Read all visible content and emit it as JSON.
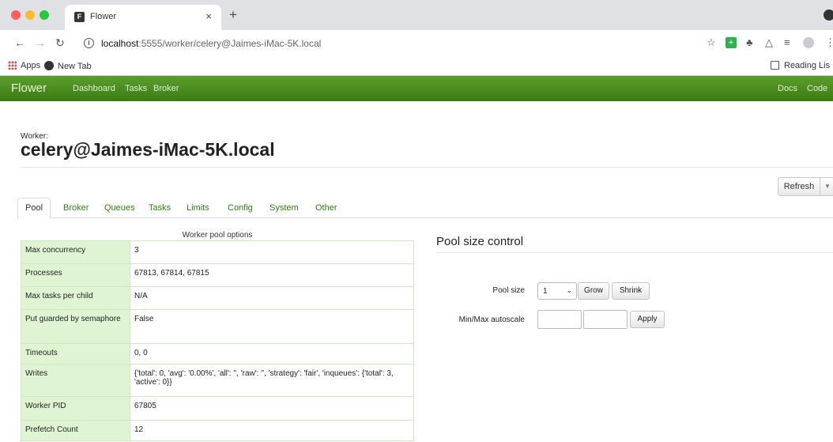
{
  "browser": {
    "tab_title": "Flower",
    "tab_favicon": "F",
    "close_glyph": "×",
    "new_tab_glyph": "+",
    "url_host": "localhost",
    "url_path": ":5555/worker/celery@Jaimes-iMac-5K.local",
    "colors": {
      "close": "#ff5f57",
      "minimize": "#febc2e",
      "maximize": "#28c840"
    }
  },
  "bookmarks": {
    "apps_label": "Apps",
    "newtab_label": "New Tab",
    "reading_list_label": "Reading Lis"
  },
  "navbar": {
    "brand": "Flower",
    "links": [
      "Dashboard",
      "Tasks",
      "Broker"
    ],
    "right_links": [
      "Docs",
      "Code"
    ],
    "color": "#4a8a1e"
  },
  "worker": {
    "label": "Worker:",
    "name": "celery@Jaimes-iMac-5K.local"
  },
  "refresh": {
    "label": "Refresh"
  },
  "tabs": [
    "Pool",
    "Broker",
    "Queues",
    "Tasks",
    "Limits",
    "Config",
    "System",
    "Other"
  ],
  "pool_options": {
    "caption": "Worker pool options",
    "rows": [
      {
        "key": "Max concurrency",
        "value": "3"
      },
      {
        "key": "Processes",
        "value": "67813, 67814, 67815"
      },
      {
        "key": "Max tasks per child",
        "value": "N/A"
      },
      {
        "key": "Put guarded by semaphore",
        "value": "False"
      },
      {
        "key": "Timeouts",
        "value": "0, 0"
      },
      {
        "key": "Writes",
        "value": "{'total': 0, 'avg': '0.00%', 'all': '', 'raw': '', 'strategy': 'fair', 'inqueues': {'total': 3, 'active': 0}}"
      },
      {
        "key": "Worker PID",
        "value": "67805"
      },
      {
        "key": "Prefetch Count",
        "value": "12"
      }
    ]
  },
  "pool_control": {
    "title": "Pool size control",
    "pool_size_label": "Pool size",
    "pool_size_value": "1",
    "grow_label": "Grow",
    "shrink_label": "Shrink",
    "autoscale_label": "Min/Max autoscale",
    "apply_label": "Apply"
  }
}
